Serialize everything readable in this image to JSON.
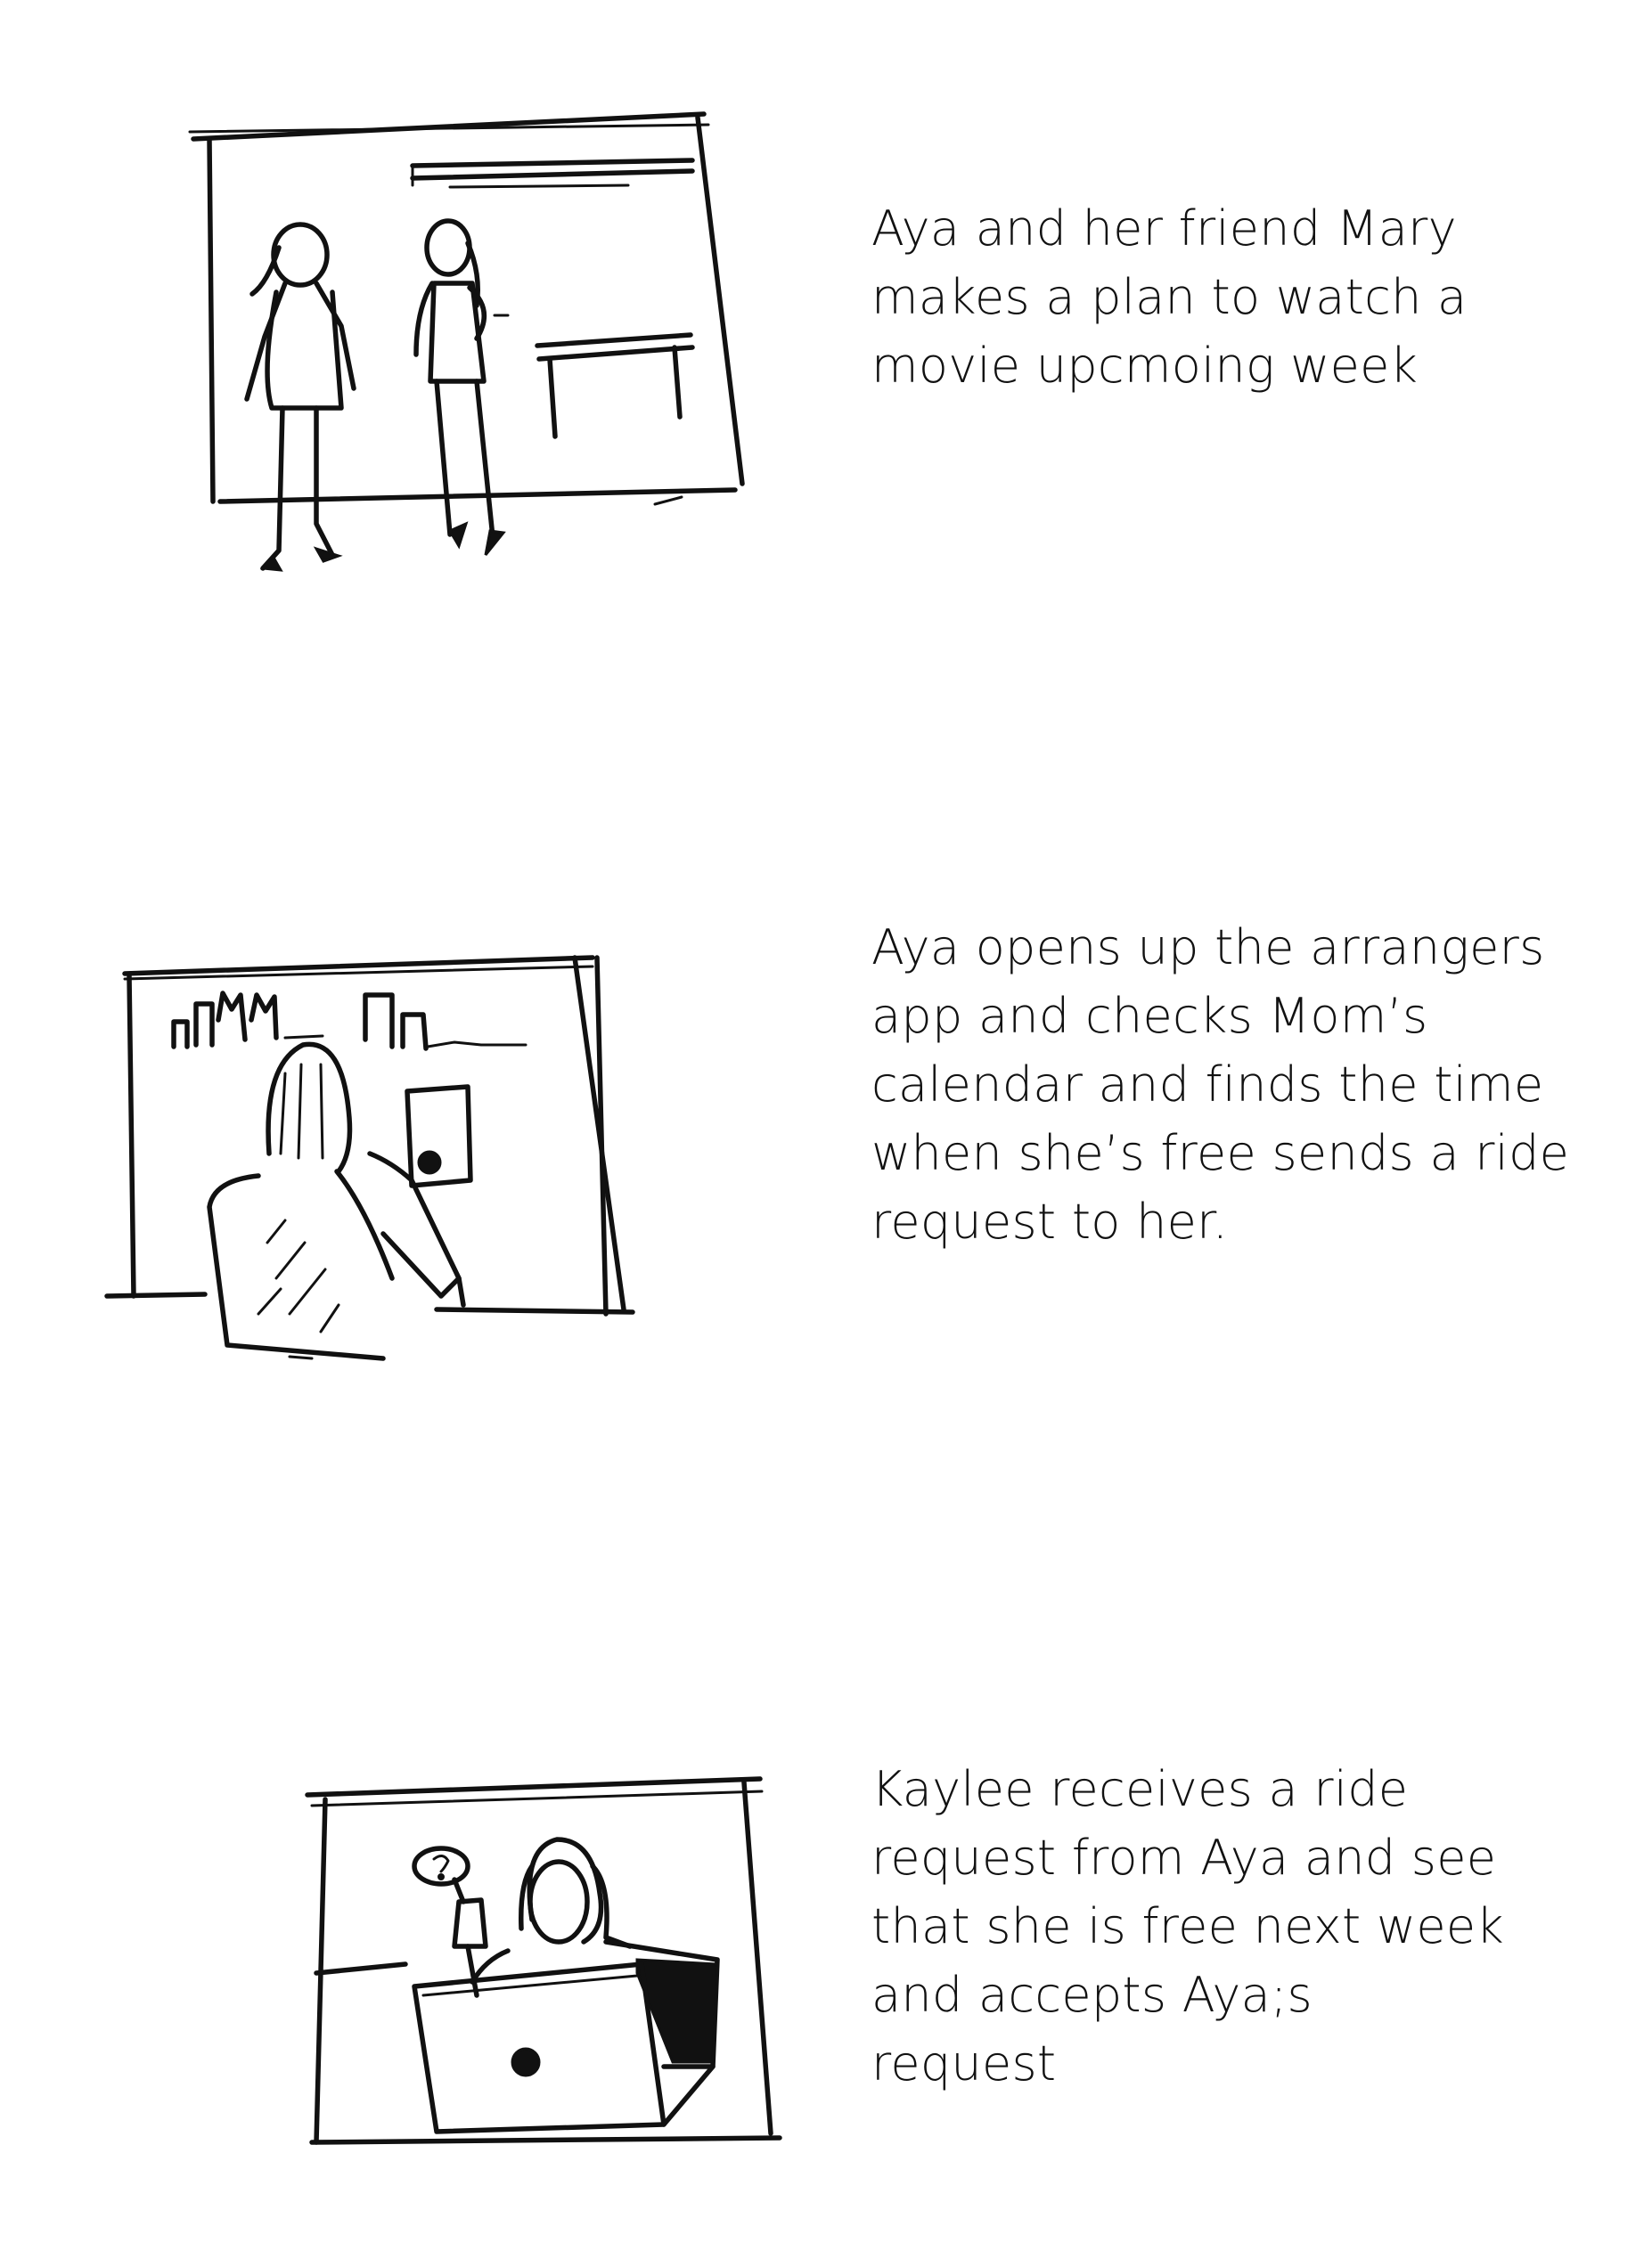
{
  "storyboard": {
    "frames": [
      {
        "caption": "Aya and her friend Mary\nmakes a plan to watch a\nmovie upcmoing week",
        "sketch_icon": "two-people-standing-sketch"
      },
      {
        "caption": "Aya opens up the arrangers\napp and checks Mom’s\ncalendar and finds the time\nwhen she’s free sends a ride\nrequest to her.",
        "sketch_icon": "person-holding-phone-sketch"
      },
      {
        "caption": "Kaylee receives a ride\nrequest from Aya and see\nthat she is free next week\nand accepts Aya;s\nrequest",
        "sketch_icon": "person-at-laptop-sketch"
      }
    ]
  },
  "colors": {
    "ink": "#111111",
    "paper": "#ffffff"
  }
}
